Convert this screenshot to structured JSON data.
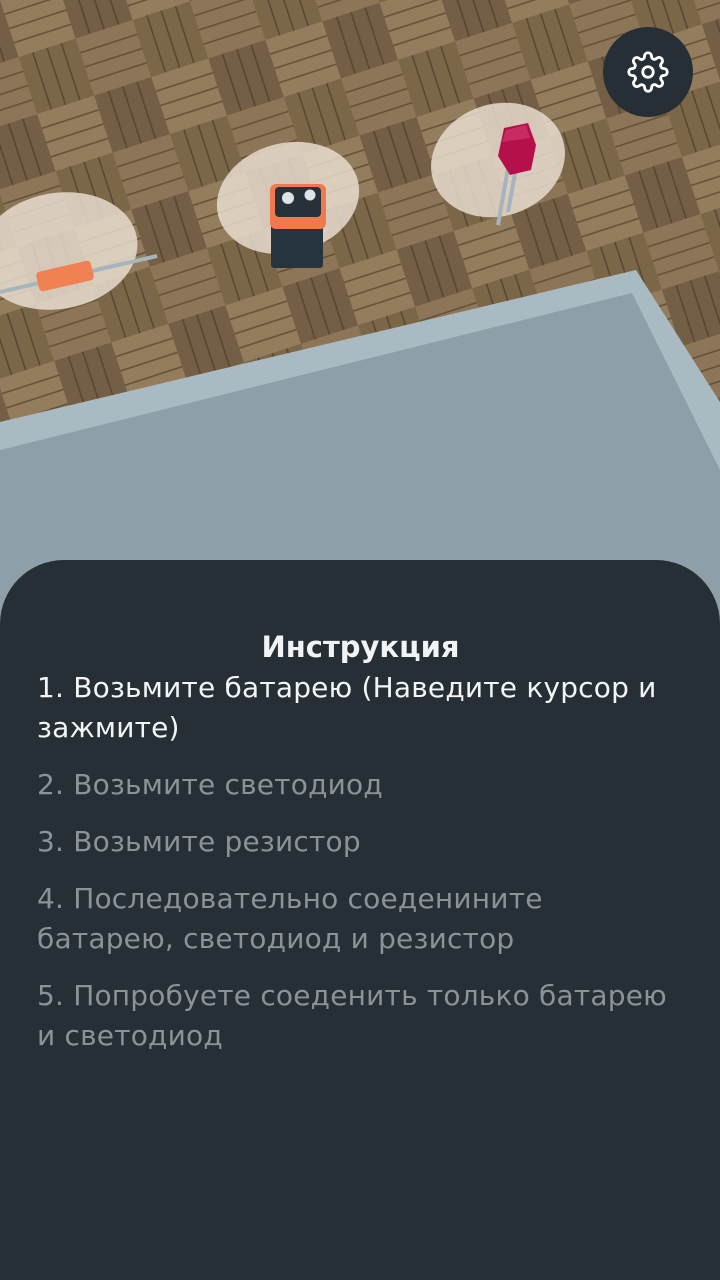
{
  "colors": {
    "panel_bg": "#262f36",
    "active_text": "#f3f5f6",
    "inactive_text": "#8b9398",
    "table_surface": "#8e9fa9",
    "table_edge": "#a9bac3",
    "battery_body": "#263440",
    "battery_top": "#f07a4e",
    "resistor": "#ef8152",
    "led": "#b5104b",
    "disc": "#ece0d3"
  },
  "header": {
    "settings_icon": "gear-icon"
  },
  "scene": {
    "objects": [
      "resistor",
      "battery",
      "led"
    ]
  },
  "instructions": {
    "title": "Инструкция",
    "steps": [
      {
        "text": "1. Возьмите батарею (Наведите курсор и зажмите)",
        "active": true
      },
      {
        "text": "2. Возьмите светодиод",
        "active": false
      },
      {
        "text": "3. Возьмите резистор",
        "active": false
      },
      {
        "text": "4. Последовательно соеденините батарею, светодиод и резистор",
        "active": false
      },
      {
        "text": "5. Попробуете соеденить только батарею и светодиод",
        "active": false
      }
    ]
  }
}
